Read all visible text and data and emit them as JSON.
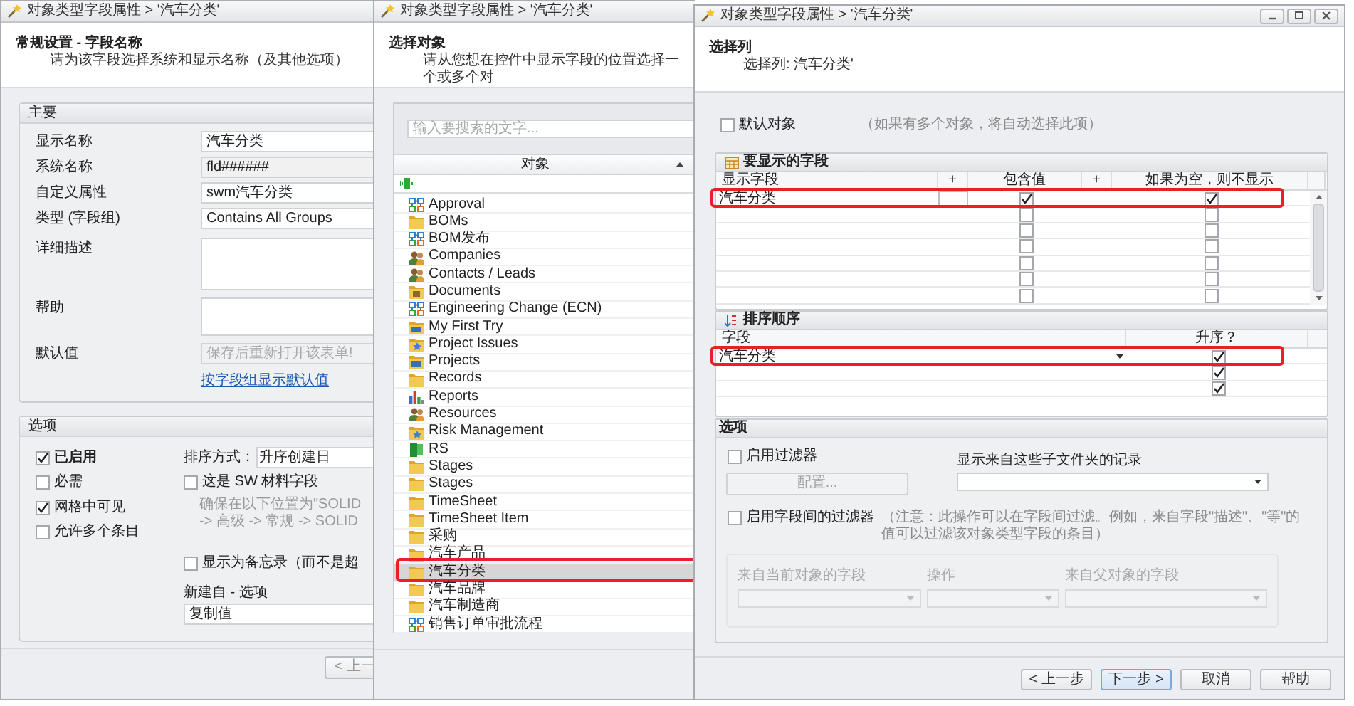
{
  "field_window": {
    "title": "对象类型字段属性 > '汽车分类'",
    "heading": "常规设置 - 字段名称",
    "description": "请为该字段选择系统和显示名称（及其他选项）",
    "main_group": {
      "title": "主要",
      "fields": [
        {
          "label": "显示名称",
          "kind": "text",
          "value": "汽车分类"
        },
        {
          "label": "系统名称",
          "kind": "readonly",
          "value": "fld######"
        },
        {
          "label": "自定义属性",
          "kind": "text",
          "value": "swm汽车分类"
        },
        {
          "label": "类型 (字段组)",
          "kind": "text",
          "value": "Contains All Groups"
        },
        {
          "label": "详细描述",
          "kind": "textarea"
        },
        {
          "label": "帮助",
          "kind": "textarea"
        },
        {
          "label": "默认值",
          "kind": "readonly",
          "placeholder": "保存后重新打开该表单!"
        }
      ],
      "link": "按字段组显示默认值"
    },
    "options_group": {
      "title": "选项",
      "checkboxes": [
        {
          "label": "已启用",
          "checked": true,
          "bold": true
        },
        {
          "label": "必需",
          "checked": false,
          "bold": false
        },
        {
          "label": "网格中可见",
          "checked": true,
          "bold": false
        },
        {
          "label": "允许多个条目",
          "checked": false,
          "bold": false
        }
      ],
      "sort_label": "排序方式：",
      "sort_value": "升序创建日",
      "material_checkbox": {
        "label": "这是 SW 材料字段",
        "checked": false
      },
      "hint_lines": [
        "确保在以下位置为\"SOLID",
        "-> 高级 -> 常规 -> SOLID"
      ],
      "memo_checkbox": {
        "label": "显示为备忘录（而不是超",
        "checked": false
      },
      "new_from_label": "新建自 - 选项",
      "new_from_value": "复制值"
    },
    "buttons": [
      "< 上一"
    ]
  },
  "object_window": {
    "title": "对象类型字段属性 > '汽车分类'",
    "heading": "选择对象",
    "description": "请从您想在控件中显示字段的位置选择一个或多个对",
    "search": {
      "placeholder": "输入要搜索的文字..."
    },
    "column": "对象",
    "items": [
      {
        "label": "Approval",
        "kind": "workflow",
        "selected": false,
        "annotated": false
      },
      {
        "label": "BOMs",
        "kind": "folder",
        "selected": false,
        "annotated": false
      },
      {
        "label": "BOM发布",
        "kind": "workflow",
        "selected": false,
        "annotated": false
      },
      {
        "label": "Companies",
        "kind": "people",
        "selected": false,
        "annotated": false
      },
      {
        "label": "Contacts / Leads",
        "kind": "people",
        "selected": false,
        "annotated": false
      },
      {
        "label": "Documents",
        "kind": "document-folder",
        "selected": false,
        "annotated": false
      },
      {
        "label": "Engineering Change (ECN)",
        "kind": "workflow",
        "selected": false,
        "annotated": false
      },
      {
        "label": "My First Try",
        "kind": "monitor-folder",
        "selected": false,
        "annotated": false
      },
      {
        "label": "Project Issues",
        "kind": "star-folder",
        "selected": false,
        "annotated": false
      },
      {
        "label": "Projects",
        "kind": "monitor-folder",
        "selected": false,
        "annotated": false
      },
      {
        "label": "Records",
        "kind": "folder",
        "selected": false,
        "annotated": false
      },
      {
        "label": "Reports",
        "kind": "chart",
        "selected": false,
        "annotated": false
      },
      {
        "label": "Resources",
        "kind": "people",
        "selected": false,
        "annotated": false
      },
      {
        "label": "Risk Management",
        "kind": "star-folder",
        "selected": false,
        "annotated": false
      },
      {
        "label": "RS",
        "kind": "green-block",
        "selected": false,
        "annotated": false
      },
      {
        "label": "Stages",
        "kind": "folder",
        "selected": false,
        "annotated": false
      },
      {
        "label": "Stages",
        "kind": "folder",
        "selected": false,
        "annotated": false
      },
      {
        "label": "TimeSheet",
        "kind": "folder",
        "selected": false,
        "annotated": false
      },
      {
        "label": "TimeSheet Item",
        "kind": "folder",
        "selected": false,
        "annotated": false
      },
      {
        "label": "采购",
        "kind": "folder",
        "selected": false,
        "annotated": false
      },
      {
        "label": "汽车产品",
        "kind": "folder",
        "selected": false,
        "annotated": false
      },
      {
        "label": "汽车分类",
        "kind": "folder",
        "selected": true,
        "annotated": true
      },
      {
        "label": "汽车品牌",
        "kind": "folder",
        "selected": false,
        "annotated": false
      },
      {
        "label": "汽车制造商",
        "kind": "folder",
        "selected": false,
        "annotated": false
      },
      {
        "label": "销售订单审批流程",
        "kind": "workflow",
        "selected": false,
        "annotated": false
      }
    ]
  },
  "column_window": {
    "title": "对象类型字段属性 > '汽车分类'",
    "heading": "选择列",
    "description": "选择列: 汽车分类'",
    "default_object": {
      "label": "默认对象",
      "checked": false
    },
    "default_hint": "（如果有多个对象，将自动选择此项）",
    "display_fields": {
      "title": "要显示的字段",
      "columns": [
        "显示字段",
        "+",
        "包含值",
        "+",
        "如果为空，则不显示"
      ],
      "rows": [
        {
          "field": "汽车分类",
          "include_value": true,
          "hide_if_empty": true,
          "annotated": true
        },
        {
          "include_value": false,
          "hide_if_empty": false,
          "annotated": false
        },
        {
          "include_value": false,
          "hide_if_empty": false,
          "annotated": false
        },
        {
          "include_value": false,
          "hide_if_empty": false,
          "annotated": false
        },
        {
          "include_value": false,
          "hide_if_empty": false,
          "annotated": false
        },
        {
          "include_value": false,
          "hide_if_empty": false,
          "annotated": false
        },
        {
          "include_value": false,
          "hide_if_empty": false,
          "annotated": false
        }
      ]
    },
    "sort_order": {
      "title": "排序顺序",
      "columns": [
        "字段",
        "升序？"
      ],
      "rows": [
        {
          "field": "汽车分类",
          "ascending": true,
          "annotated": true
        },
        {
          "ascending": true,
          "annotated": false
        },
        {
          "ascending": true,
          "annotated": false
        }
      ]
    },
    "options": {
      "title": "选项",
      "filter_checkbox": {
        "label": "启用过滤器",
        "checked": false
      },
      "configure_button": {
        "label": "配置...",
        "disabled": true
      },
      "subfolder_label": "显示来自这些子文件夹的记录",
      "field_filter_checkbox": {
        "label": "启用字段间的过滤器",
        "checked": false
      },
      "note": "（注意：此操作可以在字段间过滤。例如，来自字段\"描述\"、\"等\"的值可以过滤该对象类型字段的条目）",
      "filter_labels": [
        "来自当前对象的字段",
        "操作",
        "来自父对象的字段"
      ]
    },
    "buttons": [
      {
        "label": "< 上一步",
        "default": false
      },
      {
        "label": "下一步 >",
        "default": true
      },
      {
        "label": "取消",
        "default": false
      },
      {
        "label": "帮助",
        "default": false
      }
    ]
  }
}
